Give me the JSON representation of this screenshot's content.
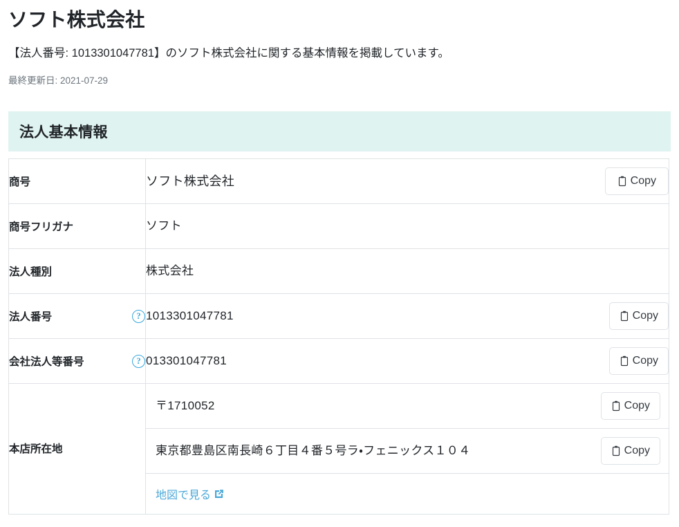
{
  "page": {
    "title": "ソフト株式会社",
    "lead": "【法人番号: 1013301047781】のソフト株式会社に関する基本情報を掲載しています。",
    "last_updated": "最終更新日: 2021-07-29"
  },
  "section": {
    "heading": "法人基本情報"
  },
  "labels": {
    "trade_name": "商号",
    "trade_name_kana": "商号フリガナ",
    "corporate_type": "法人種別",
    "corporate_number": "法人番号",
    "company_registry_number": "会社法人等番号",
    "head_office_address": "本店所在地"
  },
  "values": {
    "trade_name": "ソフト株式会社",
    "trade_name_kana": "ソフト",
    "corporate_type": "株式会社",
    "corporate_number": "1013301047781",
    "company_registry_number": "013301047781",
    "postal_code": "〒1710052",
    "address": "東京都豊島区南長崎６丁目４番５号ラ・フェニックス１０４"
  },
  "buttons": {
    "copy_label": "Copy",
    "copy_icon": "clipboard-icon"
  },
  "links": {
    "map_label": "地図で見る",
    "map_icon": "external-link-icon"
  },
  "icons": {
    "help": "?",
    "help_name": "help-circle-icon"
  },
  "colors": {
    "section_bar_bg": "#dff3f0",
    "help_icon": "#37a7dd",
    "link": "#4aa8d8",
    "border": "#dee2e6",
    "muted_text": "#6c757d",
    "text": "#212529"
  }
}
